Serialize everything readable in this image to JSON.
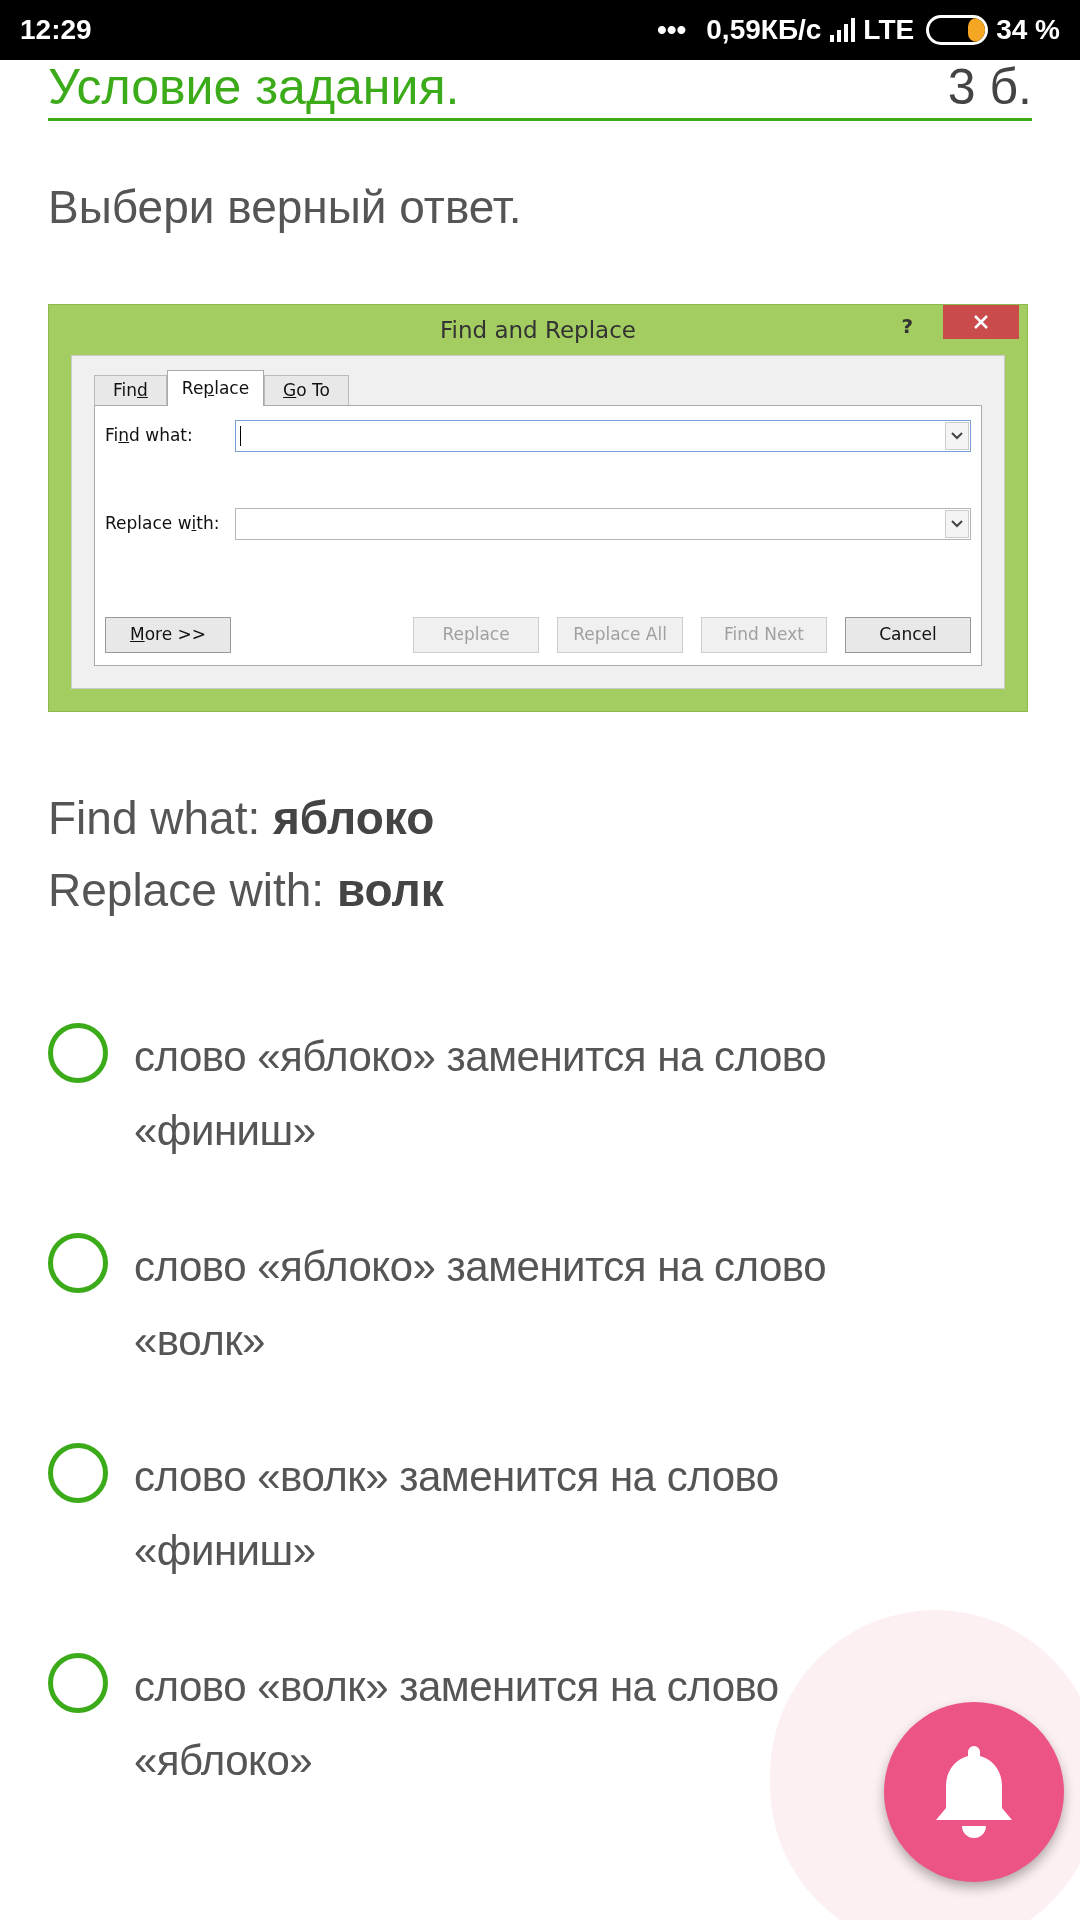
{
  "status_bar": {
    "time": "12:29",
    "dots": "•••",
    "speed": "0,59КБ/с",
    "network": "LTE",
    "battery": "34 %"
  },
  "header": {
    "title": "Условие задания.",
    "points": "3 б."
  },
  "prompt": "Выбери верный ответ.",
  "dialog": {
    "title": "Find and Replace",
    "help": "?",
    "tabs": [
      {
        "label_parts": [
          {
            "text": "Fin",
            "underlined": false
          },
          {
            "text": "d",
            "underlined": true
          }
        ],
        "selected": false
      },
      {
        "label_parts": [
          {
            "text": "Re",
            "underlined": false
          },
          {
            "text": "p",
            "underlined": true
          },
          {
            "text": "lace",
            "underlined": false
          }
        ],
        "selected": true
      },
      {
        "label_parts": [
          {
            "text": "G",
            "underlined": true
          },
          {
            "text": "o To",
            "underlined": false
          }
        ],
        "selected": false
      }
    ],
    "fields": [
      {
        "label_parts": [
          {
            "text": "Fi",
            "underlined": false
          },
          {
            "text": "n",
            "underlined": true
          },
          {
            "text": "d what:",
            "underlined": false
          }
        ],
        "focused": true
      },
      {
        "label_parts": [
          {
            "text": "Replace w",
            "underlined": false
          },
          {
            "text": "i",
            "underlined": true
          },
          {
            "text": "th:",
            "underlined": false
          }
        ],
        "focused": false
      }
    ],
    "buttons": [
      {
        "label_parts": [
          {
            "text": "M",
            "underlined": true
          },
          {
            "text": "ore >>",
            "underlined": false
          }
        ],
        "disabled": false
      },
      {
        "label_parts": [
          {
            "text": "Replace",
            "underlined": false
          }
        ],
        "disabled": true
      },
      {
        "label_parts": [
          {
            "text": "Replace All",
            "underlined": false
          }
        ],
        "disabled": true
      },
      {
        "label_parts": [
          {
            "text": "Find Next",
            "underlined": false
          }
        ],
        "disabled": true
      },
      {
        "label_parts": [
          {
            "text": "Cancel",
            "underlined": false
          }
        ],
        "disabled": false
      }
    ]
  },
  "given": [
    {
      "label": "Find what:",
      "value": "яблоко"
    },
    {
      "label": "Replace with:",
      "value": "волк"
    }
  ],
  "options": [
    {
      "text": "слово «яблоко» заменится на слово «финиш»",
      "selected": false
    },
    {
      "text": "слово «яблоко» заменится на слово «волк»",
      "selected": false
    },
    {
      "text": "слово «волк» заменится на слово «финиш»",
      "selected": false
    },
    {
      "text": "слово «волк» заменится на слово «яблоко»",
      "selected": false
    }
  ]
}
